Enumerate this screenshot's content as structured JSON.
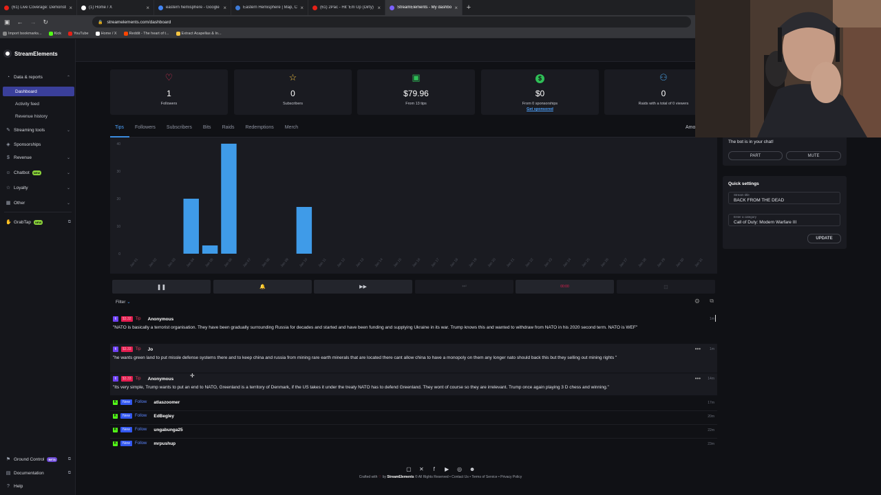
{
  "browser": {
    "tabs": [
      {
        "title": "(61) Live Coverage: Demonstrati",
        "color": "#e62117"
      },
      {
        "title": "(1) Home / X",
        "color": "#ffffff"
      },
      {
        "title": "eastern hemisphere - Google S",
        "color": "#4285f4"
      },
      {
        "title": "Eastern Hemisphere | Map, Cor",
        "color": "#3d7bd8"
      },
      {
        "title": "(61) 2Pac - Hit 'Em Up (Dirty) (V",
        "color": "#e62117"
      },
      {
        "title": "StreamElements - My dashboar",
        "color": "#7b61ff"
      }
    ],
    "new_tab": "+",
    "url": "streamelements.com/dashboard",
    "bookmarks": [
      "Import bookmarks...",
      "Kick",
      "YouTube",
      "Home / X",
      "Reddit - The heart of t...",
      "Extract Acapellas & In..."
    ]
  },
  "sidebar": {
    "brand": "StreamElements",
    "items": [
      {
        "label": "Data & reports",
        "icon": "chart-pie-icon"
      },
      {
        "label": "Dashboard"
      },
      {
        "label": "Activity feed"
      },
      {
        "label": "Revenue history"
      },
      {
        "label": "Streaming tools",
        "icon": "tools-icon"
      },
      {
        "label": "Sponsorships",
        "icon": "handshake-icon"
      },
      {
        "label": "Revenue",
        "icon": "dollar-icon"
      },
      {
        "label": "Chatbot",
        "icon": "robot-icon",
        "badge": "NEW"
      },
      {
        "label": "Loyalty",
        "icon": "star-icon"
      },
      {
        "label": "Other",
        "icon": "grid-icon"
      },
      {
        "label": "GrabTap",
        "icon": "hand-icon",
        "badge": "NEW"
      }
    ],
    "bottom": [
      {
        "label": "Ground Control",
        "badge": "BETA"
      },
      {
        "label": "Documentation"
      },
      {
        "label": "Help"
      }
    ]
  },
  "stats": [
    {
      "value": "1",
      "label": "Followers",
      "icon": "heart-icon",
      "color": "#e8355a"
    },
    {
      "value": "0",
      "label": "Subscribers",
      "icon": "star-icon",
      "color": "#f5c542"
    },
    {
      "value": "$79.96",
      "label": "From 13 tips",
      "icon": "cash-icon",
      "color": "#2fbf57"
    },
    {
      "value": "$0",
      "label": "From 0 sponsorships",
      "link": "Get sponsored",
      "icon": "dollar-circle-icon",
      "color": "#2fbf57"
    },
    {
      "value": "0",
      "label": "Raids with a total of 0 viewers",
      "icon": "users-icon",
      "color": "#49a3e8"
    }
  ],
  "chart_tabs": [
    "Tips",
    "Followers",
    "Subscribers",
    "Bits",
    "Raids",
    "Redemptions",
    "Merch"
  ],
  "chart_extra": "Amo",
  "chart_data": {
    "type": "bar",
    "categories": [
      "Jan 01",
      "Jan 02",
      "Jan 03",
      "Jan 04",
      "Jan 05",
      "Jan 06",
      "Jan 07",
      "Jan 08",
      "Jan 09",
      "Jan 10",
      "Jan 11",
      "Jan 12",
      "Jan 13",
      "Jan 14",
      "Jan 15",
      "Jan 16",
      "Jan 17",
      "Jan 18",
      "Jan 19",
      "Jan 20",
      "Jan 21",
      "Jan 22",
      "Jan 23",
      "Jan 24",
      "Jan 25",
      "Jan 26",
      "Jan 27",
      "Jan 28",
      "Jan 29",
      "Jan 30",
      "Jan 31"
    ],
    "values": [
      0,
      0,
      0,
      20,
      3,
      40,
      0,
      0,
      0,
      17,
      0,
      0,
      0,
      0,
      0,
      0,
      0,
      0,
      0,
      0,
      0,
      0,
      0,
      0,
      0,
      0,
      0,
      0,
      0,
      0,
      0
    ],
    "yticks": [
      "0",
      "10",
      "20",
      "30",
      "40"
    ],
    "ylim": [
      0,
      40
    ],
    "color": "#3f9be8"
  },
  "controls": [
    "❚❚",
    "🔔",
    "▶▶",
    "⏭",
    "00:00",
    "⊡"
  ],
  "filter_label": "Filter",
  "events": [
    {
      "type": "tip",
      "amount": "$3.32",
      "kind": "Tip",
      "user": "Anonymous",
      "time": "1m",
      "message": "\"NATO is basically a terrorist organisation. They have been gradually surrounding Russia for decades and started and have been funding and supplying Ukraine in its war. Trump knows this and wanted to withdraw from NATO in his 2020 second term. NATO is WEF\""
    },
    {
      "type": "tip",
      "amount": "$3.33",
      "kind": "Tip",
      "user": "Jo",
      "time": "1m",
      "message": "\"he wants green land to put missle defense systems there and to keep china and russia from mining rare earth minerals that are located there cant allow china to have a monopoly on them any longer nato should back this but they selling out mining rights \""
    },
    {
      "type": "tip",
      "amount": "$3.33",
      "kind": "Tip",
      "user": "Anonymous",
      "time": "14m",
      "message": "\"Its very simple, Trump wants to put an end to NATO, Greenland is a territory of Denmark, if the US takes it under the treaty NATO has to defend Greenland. They wont of course so they are irrelevant. Trump once again playing 3 D chess and winning.\""
    },
    {
      "type": "follow",
      "badge": "New",
      "kind": "Follow",
      "user": "atlaszoomer",
      "time": "17m"
    },
    {
      "type": "follow",
      "badge": "New",
      "kind": "Follow",
      "user": "EdBegley",
      "time": "20m"
    },
    {
      "type": "follow",
      "badge": "New",
      "kind": "Follow",
      "user": "ungabunga25",
      "time": "22m"
    },
    {
      "type": "follow",
      "badge": "New",
      "kind": "Follow",
      "user": "mrpushup",
      "time": "23m"
    }
  ],
  "footer": {
    "social_icons": [
      "twitch-icon",
      "x-icon",
      "facebook-icon",
      "youtube-icon",
      "instagram-icon",
      "discord-icon"
    ],
    "crafted": "Crafted with",
    "by": "by",
    "brand": "StreamElements",
    "links": "© All Rights Reserved  •  Contact Us  •  Terms of Service  •  Privacy Policy"
  },
  "bot_panel": {
    "status": "The bot is in your chat!",
    "part": "PART",
    "mute": "MUTE"
  },
  "quick_settings": {
    "title": "Quick settings",
    "stream_title_label": "Stream title",
    "stream_title": "BACK FROM THE DEAD",
    "category_label": "Enter a category",
    "category": "Call of Duty: Modern Warfare III",
    "update": "UPDATE"
  }
}
